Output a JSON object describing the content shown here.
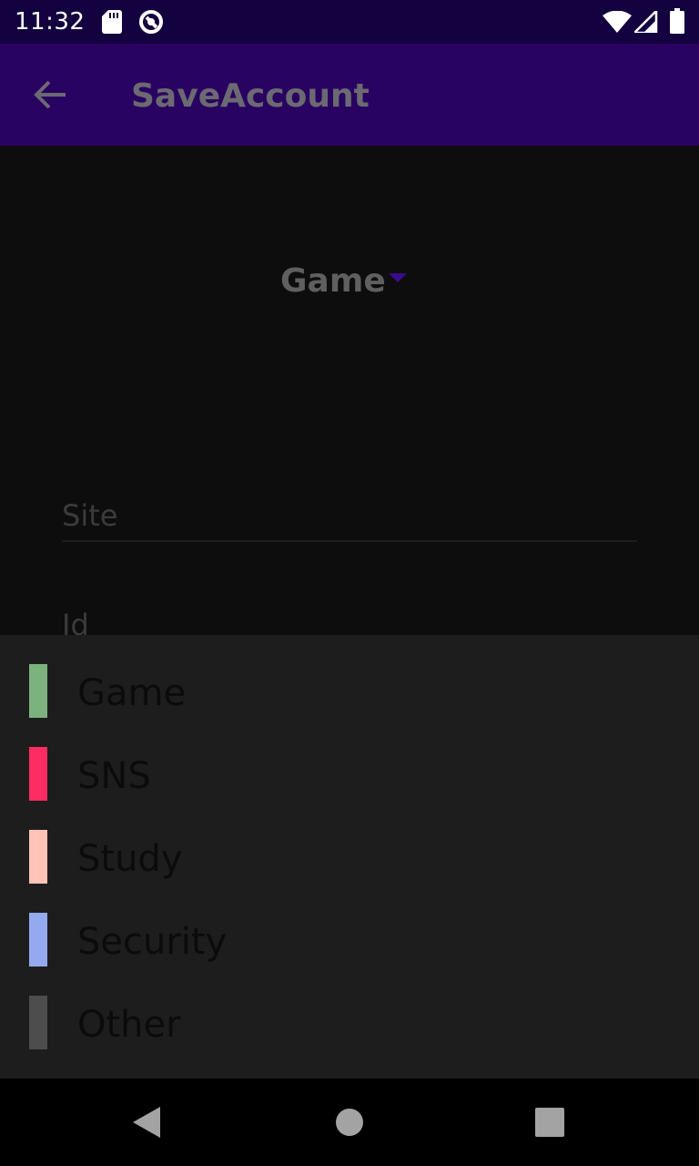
{
  "status_bar": {
    "time": "11:32",
    "icons": [
      "sd-card-icon",
      "vpn-key-icon",
      "wifi-icon",
      "signal-icon",
      "battery-icon"
    ]
  },
  "app_bar": {
    "title": "SaveAccount",
    "back_icon": "arrow-back-icon"
  },
  "form": {
    "category_spinner": {
      "selected": "Game",
      "icon": "dropdown-arrow-icon"
    },
    "site_field": {
      "placeholder": "Site",
      "value": ""
    },
    "id_field": {
      "placeholder": "Id",
      "value": ""
    }
  },
  "dropdown": {
    "items": [
      {
        "label": "Game",
        "color": "#7cb27e"
      },
      {
        "label": "SNS",
        "color": "#ff2b62"
      },
      {
        "label": "Study",
        "color": "#ffc3b7"
      },
      {
        "label": "Security",
        "color": "#95a9ef"
      },
      {
        "label": "Other",
        "color": "#4d4d4d"
      }
    ]
  },
  "nav_bar": {
    "icons": [
      "nav-back-icon",
      "nav-home-icon",
      "nav-recents-icon"
    ]
  },
  "colors": {
    "status_bar": "#13023f",
    "app_bar": "#290361",
    "accent": "#3a0b8a"
  }
}
